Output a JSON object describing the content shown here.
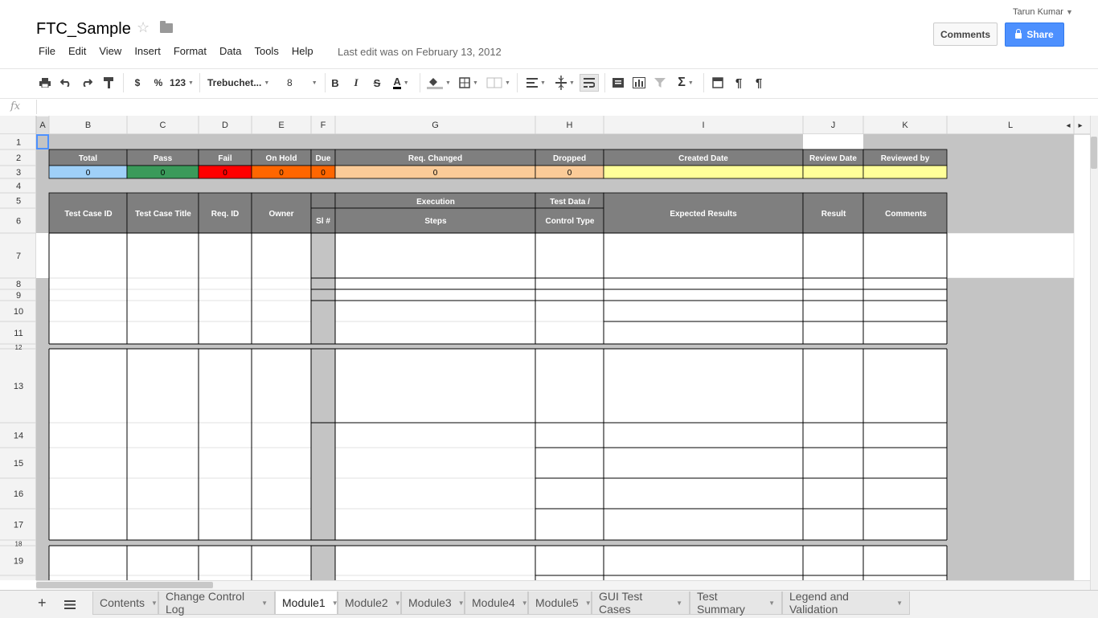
{
  "doc": {
    "title": "FTC_Sample",
    "last_edit": "Last edit was on February 13, 2012"
  },
  "user": {
    "name": "Tarun Kumar"
  },
  "buttons": {
    "comments": "Comments",
    "share": "Share"
  },
  "menu": [
    "File",
    "Edit",
    "View",
    "Insert",
    "Format",
    "Data",
    "Tools",
    "Help"
  ],
  "toolbar": {
    "currency": "$",
    "percent": "%",
    "number_format": "123",
    "font": "Trebuchet...",
    "font_size": "8",
    "bold": "B",
    "italic": "I",
    "strike": "S",
    "text_color": "A",
    "sum": "Σ",
    "pilcrow": "¶"
  },
  "formula_bar": {
    "fx": "fx"
  },
  "columns": [
    "A",
    "B",
    "C",
    "D",
    "E",
    "F",
    "G",
    "H",
    "I",
    "J",
    "K",
    "L"
  ],
  "rows": [
    "1",
    "2",
    "3",
    "4",
    "5",
    "6",
    "7",
    "8",
    "9",
    "10",
    "11",
    "12",
    "13",
    "14",
    "15",
    "16",
    "17",
    "18",
    "19"
  ],
  "sheet": {
    "summary_headers": [
      "Total",
      "Pass",
      "Fail",
      "On Hold",
      "Due",
      "Req. Changed",
      "Dropped",
      "Created Date",
      "Review Date",
      "Reviewed by"
    ],
    "summary_values": [
      "0",
      "0",
      "0",
      "0",
      "0",
      "0",
      "0"
    ],
    "table_headers": {
      "test_case_id": "Test Case ID",
      "test_case_title": "Test Case Title",
      "req_id": "Req. ID",
      "owner": "Owner",
      "sl": "Sl #",
      "execution": "Execution",
      "steps": "Steps",
      "test_data_1": "Test Data /",
      "test_data_2": "Control Type",
      "expected": "Expected Results",
      "result": "Result",
      "comments": "Comments"
    }
  },
  "colors": {
    "header_gray": "#7f7f7f",
    "total": "#9fd0f8",
    "pass": "#3a9a5a",
    "fail": "#ff0000",
    "on_hold": "#ff6600",
    "due": "#ff6600",
    "req_changed": "#fbcb98",
    "dropped": "#fbcb98",
    "dates": "#ffff99",
    "filler": "#c4c4c4"
  },
  "tabs": [
    "Contents",
    "Change Control Log",
    "Module1",
    "Module2",
    "Module3",
    "Module4",
    "Module5",
    "GUI Test Cases",
    "Test Summary",
    "Legend and Validation"
  ],
  "active_tab": "Module1"
}
